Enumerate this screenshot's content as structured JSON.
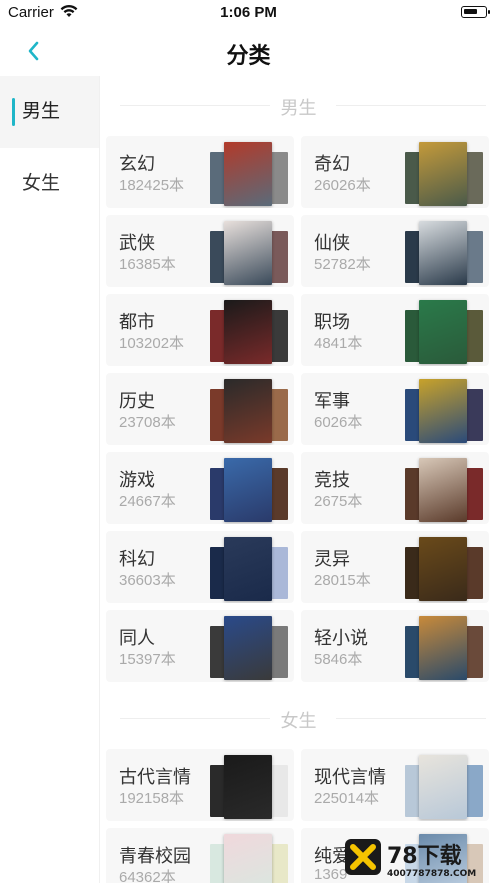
{
  "status_bar": {
    "carrier": "Carrier",
    "time": "1:06 PM",
    "wifi_icon": "wifi-icon",
    "battery_icon": "battery-icon"
  },
  "nav": {
    "title": "分类",
    "back_icon": "chevron-left-icon",
    "accent": "#1fb6c8"
  },
  "sidebar": {
    "items": [
      {
        "label": "男生",
        "active": true
      },
      {
        "label": "女生",
        "active": false
      }
    ]
  },
  "sections": [
    {
      "title": "男生",
      "categories": [
        {
          "name": "玄幻",
          "count": "182425本",
          "colors": [
            "#5a6b7a",
            "#b23a2a",
            "#8a8a8a"
          ]
        },
        {
          "name": "奇幻",
          "count": "26026本",
          "colors": [
            "#4a5a4a",
            "#c49a3a",
            "#6a6a5a"
          ]
        },
        {
          "name": "武侠",
          "count": "16385本",
          "colors": [
            "#3a4a5a",
            "#e8e0dc",
            "#7a5a5a"
          ]
        },
        {
          "name": "仙侠",
          "count": "52782本",
          "colors": [
            "#2a3a4a",
            "#d8dcdf",
            "#6a7a8a"
          ]
        },
        {
          "name": "都市",
          "count": "103202本",
          "colors": [
            "#7a2a2a",
            "#1a1a1a",
            "#3a3a3a"
          ]
        },
        {
          "name": "职场",
          "count": "4841本",
          "colors": [
            "#2a5a3a",
            "#2a7a4a",
            "#5a5a3a"
          ]
        },
        {
          "name": "历史",
          "count": "23708本",
          "colors": [
            "#7a3a2a",
            "#2a2a2a",
            "#9a6a4a"
          ]
        },
        {
          "name": "军事",
          "count": "6026本",
          "colors": [
            "#2a4a7a",
            "#c8a22a",
            "#3a3a5a"
          ]
        },
        {
          "name": "游戏",
          "count": "24667本",
          "colors": [
            "#2a3a6a",
            "#3a6aaa",
            "#5a3a2a"
          ]
        },
        {
          "name": "竞技",
          "count": "2675本",
          "colors": [
            "#5a3a2a",
            "#d8c8b8",
            "#7a2a2a"
          ]
        },
        {
          "name": "科幻",
          "count": "36603本",
          "colors": [
            "#1a2a4a",
            "#2a3a5a",
            "#aab8d8"
          ]
        },
        {
          "name": "灵异",
          "count": "28015本",
          "colors": [
            "#3a2a1a",
            "#6a4a1a",
            "#5a3a2a"
          ]
        },
        {
          "name": "同人",
          "count": "15397本",
          "colors": [
            "#3a3a3a",
            "#2a4a8a",
            "#7a7a7a"
          ]
        },
        {
          "name": "轻小说",
          "count": "5846本",
          "colors": [
            "#2a4a6a",
            "#c88a3a",
            "#6a4a3a"
          ]
        }
      ]
    },
    {
      "title": "女生",
      "categories": [
        {
          "name": "古代言情",
          "count": "192158本",
          "colors": [
            "#2a2a2a",
            "#1a1a1a",
            "#e8e8e8"
          ]
        },
        {
          "name": "现代言情",
          "count": "225014本",
          "colors": [
            "#b8c8d8",
            "#e8e4dc",
            "#8aa8c8"
          ]
        },
        {
          "name": "青春校园",
          "count": "64362本",
          "colors": [
            "#d8e8e0",
            "#f0d8dc",
            "#e8e8c8"
          ]
        },
        {
          "name": "纯爱",
          "count": "1369",
          "colors": [
            "#c8d8e8",
            "#6a8aaa",
            "#d8c8b8"
          ]
        }
      ]
    }
  ],
  "watermark": {
    "brand": "78下载",
    "url": "4007787878.COM"
  }
}
